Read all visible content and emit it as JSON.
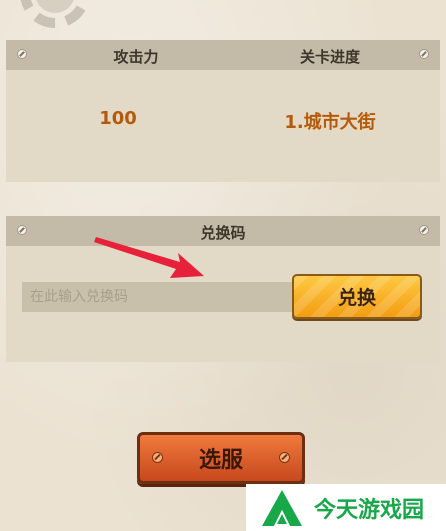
{
  "stats": {
    "attack_label": "攻击力",
    "stage_label": "关卡进度",
    "attack_value": "100",
    "stage_value": "1.城市大街"
  },
  "redeem": {
    "title": "兑换码",
    "placeholder": "在此输入兑换码",
    "value": "",
    "button_label": "兑换"
  },
  "select_server": {
    "label": "选服"
  },
  "watermark": {
    "text": "今天游戏园"
  },
  "colors": {
    "attack_value": "#b25a10",
    "redeem_button": "#f5a81c",
    "select_button": "#d9572a",
    "arrow": "#e8213a",
    "watermark": "#18a84a"
  },
  "icons": [
    "gear-icon",
    "screw-icon",
    "bolt-icon",
    "arrow-icon",
    "logo-icon"
  ]
}
